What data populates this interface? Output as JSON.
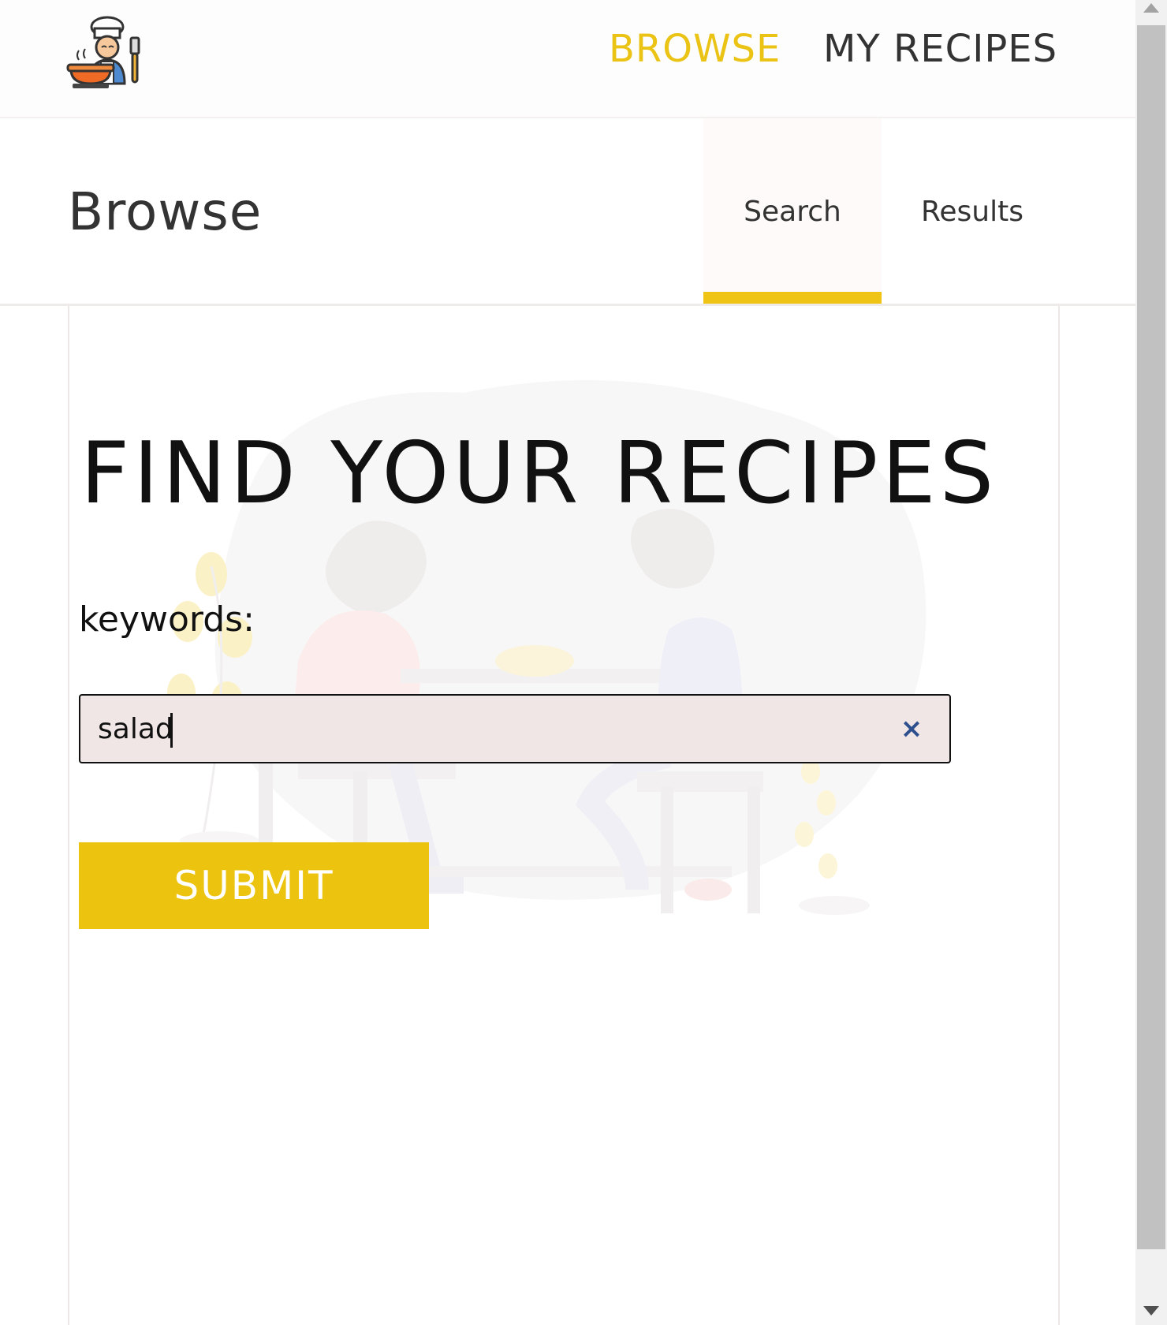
{
  "nav": {
    "browse_label": "BROWSE",
    "myrecipes_label": "MY RECIPES"
  },
  "header": {
    "title": "Browse",
    "tabs": [
      {
        "label": "Search"
      },
      {
        "label": "Results"
      }
    ]
  },
  "main": {
    "hero": "FIND YOUR RECIPES",
    "keywords_label": "keywords:",
    "search_value": "salad",
    "clear_icon": "×",
    "submit_label": "SUBMIT"
  },
  "colors": {
    "accent": "#eac314",
    "button": "#ecc30e",
    "input_bg": "#f0e6e6",
    "clear_icon": "#2d4f8e"
  },
  "icons": [
    "chef-logo-icon",
    "close-icon",
    "arrow-up-icon",
    "arrow-down-icon"
  ]
}
